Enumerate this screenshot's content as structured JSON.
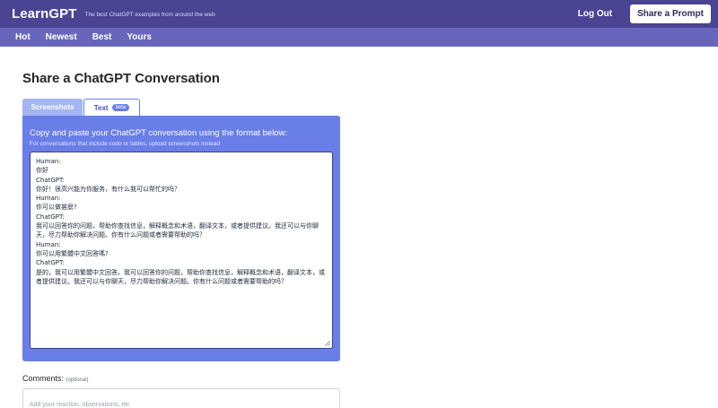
{
  "header": {
    "brand": "LearnGPT",
    "tagline": "The best ChatGPT examples from around the web",
    "logout": "Log Out",
    "share_button": "Share a Prompt"
  },
  "subnav": {
    "items": [
      "Hot",
      "Newest",
      "Best",
      "Yours"
    ]
  },
  "page": {
    "title": "Share a ChatGPT Conversation"
  },
  "tabs": {
    "screenshots": "Screenshots",
    "text": "Text",
    "beta_badge": "beta",
    "active": "text"
  },
  "panel": {
    "title": "Copy and paste your ChatGPT conversation using the format below:",
    "subtitle": "For conversations that include code or tables, upload screenshots instead"
  },
  "conversation": {
    "value": "Human:\n你好\nChatGPT:\n你好！很高兴能为你服务，有什么我可以帮忙的吗？\nHuman:\n你可以做甚麼?\nChatGPT:\n我可以回答你的问题，帮助你查找信息，解释概念和术语，翻译文本，或者提供建议。我还可以与你聊天，尽力帮助你解决问题。你有什么问题或者需要帮助的吗？\nHuman:\n你可以用繁體中文回答嗎?\nChatGPT:\n是的，我可以用繁體中文回答。我可以回答你的问题，帮助你查找信息，解释概念和术语，翻译文本，或者提供建议。我还可以与你聊天，尽力帮助你解决问题。你有什么问题或者需要帮助的吗？"
  },
  "comments": {
    "label": "Comments:",
    "optional": "(optional)",
    "placeholder": "Add your reaction, observations, etc"
  },
  "colors": {
    "topbar": "#4a4493",
    "subnav": "#6866bc",
    "panel": "#6a7ee8",
    "inactive_tab": "#a4b5f2"
  }
}
